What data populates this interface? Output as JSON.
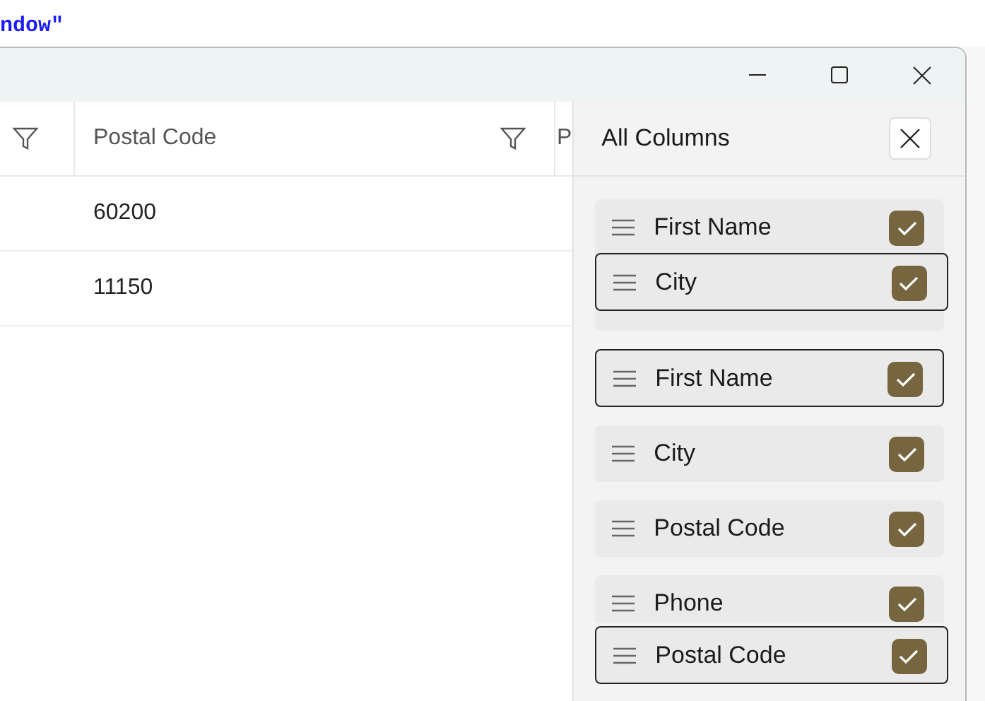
{
  "editor": {
    "code_text": "ndow\""
  },
  "grid": {
    "columns": [
      {
        "filter": true
      },
      {
        "label": "Postal Code",
        "filter": true
      },
      {
        "label": "P"
      }
    ],
    "rows": [
      {
        "postal_code": "60200"
      },
      {
        "postal_code": "11150"
      }
    ]
  },
  "column_panel": {
    "title": "All Columns",
    "items": [
      {
        "kind": "tall",
        "label": "First Name",
        "checked": true
      },
      {
        "kind": "outlined",
        "label": "First Name",
        "checked": true
      },
      {
        "kind": "row",
        "label": "City",
        "checked": true
      },
      {
        "kind": "row",
        "label": "Postal Code",
        "checked": true
      },
      {
        "kind": "partial",
        "label": "Phone",
        "checked": true
      }
    ],
    "dragged_items": [
      {
        "label": "City",
        "checked": true
      },
      {
        "label": "Postal Code",
        "checked": true
      }
    ]
  }
}
